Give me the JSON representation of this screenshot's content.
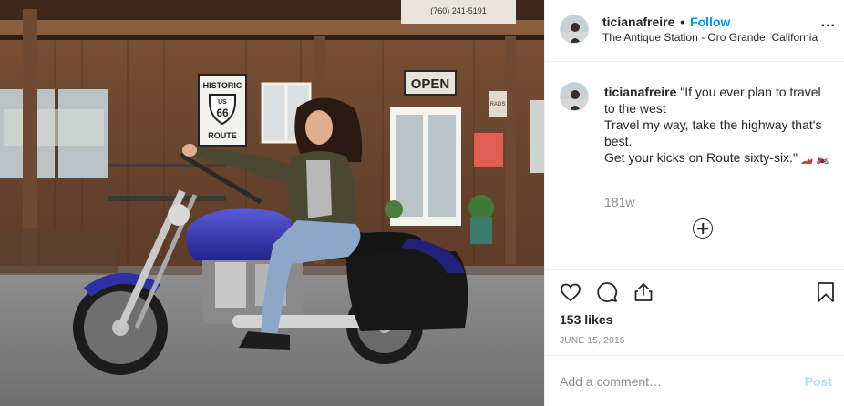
{
  "post": {
    "username": "ticianafreire",
    "follow_label": "Follow",
    "separator": "•",
    "location": "The Antique Station - Oro Grande, California",
    "more_label": "...",
    "caption_lines": [
      "\"If you ever plan to travel to the west",
      "Travel my way, take the highway that's best.",
      "Get your kicks on Route sixty-six.\""
    ],
    "caption_emoji": "🏎️ 🏍️",
    "time_ago": "181w",
    "likes": "153 likes",
    "date": "June 15, 2016",
    "comment_placeholder": "Add a comment…",
    "post_label": "Post"
  },
  "photo_signs": {
    "historic": "HISTORIC",
    "us": "US",
    "route_number": "66",
    "route": "ROUTE",
    "open": "OPEN",
    "phone": "(760) 241-5191",
    "rads": "RADS"
  },
  "icons": {
    "like": "heart-icon",
    "comment": "speech-bubble-icon",
    "share": "share-icon",
    "save": "bookmark-icon",
    "more": "ellipsis-icon",
    "load_more": "plus-circle-icon"
  },
  "colors": {
    "accent": "#0095f6",
    "post_disabled": "#b2dffc",
    "muted": "#8e8e8e",
    "text": "#262626",
    "border": "#efefef"
  }
}
